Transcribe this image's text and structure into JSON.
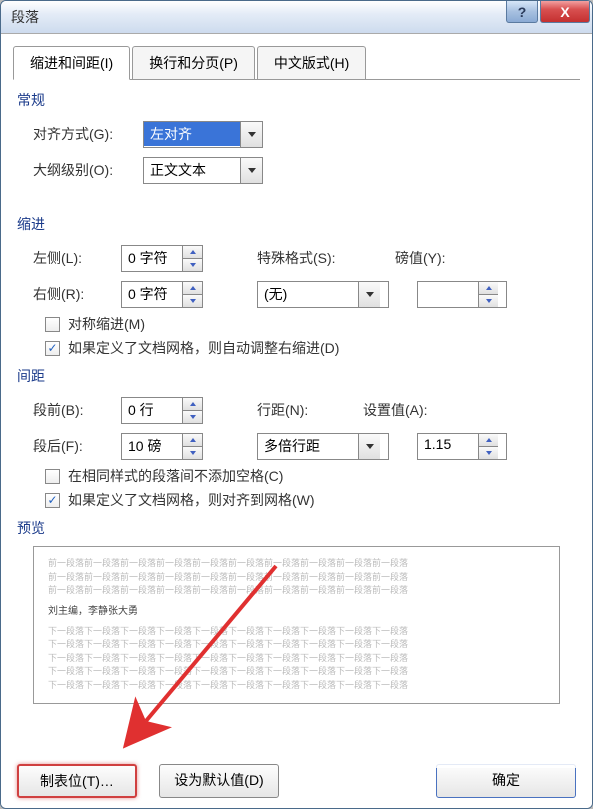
{
  "title": "段落",
  "titlebar": {
    "help": "?",
    "close": "X"
  },
  "tabs": [
    {
      "label": "缩进和间距(I)"
    },
    {
      "label": "换行和分页(P)"
    },
    {
      "label": "中文版式(H)"
    }
  ],
  "section": {
    "general": "常规",
    "indent": "缩进",
    "spacing": "间距",
    "preview": "预览"
  },
  "general": {
    "alignment_label": "对齐方式(G):",
    "alignment_value": "左对齐",
    "outline_label": "大纲级别(O):",
    "outline_value": "正文文本"
  },
  "indent": {
    "left_label": "左侧(L):",
    "left_value": "0 字符",
    "right_label": "右侧(R):",
    "right_value": "0 字符",
    "special_label": "特殊格式(S):",
    "special_value": "(无)",
    "by_label": "磅值(Y):",
    "by_value": "",
    "mirror": "对称缩进(M)",
    "auto_adjust": "如果定义了文档网格，则自动调整右缩进(D)"
  },
  "spacing": {
    "before_label": "段前(B):",
    "before_value": "0 行",
    "after_label": "段后(F):",
    "after_value": "10 磅",
    "line_label": "行距(N):",
    "line_value": "多倍行距",
    "at_label": "设置值(A):",
    "at_value": "1.15",
    "no_same_style": "在相同样式的段落间不添加空格(C)",
    "snap_grid": "如果定义了文档网格，则对齐到网格(W)"
  },
  "preview": {
    "filler": "前一段落前一段落前一段落前一段落前一段落前一段落前一段落前一段落前一段落前一段落",
    "filler2": "下一段落下一段落下一段落下一段落下一段落下一段落下一段落下一段落下一段落下一段落",
    "main": "刘主编，李静张大勇"
  },
  "buttons": {
    "tabs": "制表位(T)…",
    "default": "设为默认值(D)",
    "ok": "确定"
  }
}
